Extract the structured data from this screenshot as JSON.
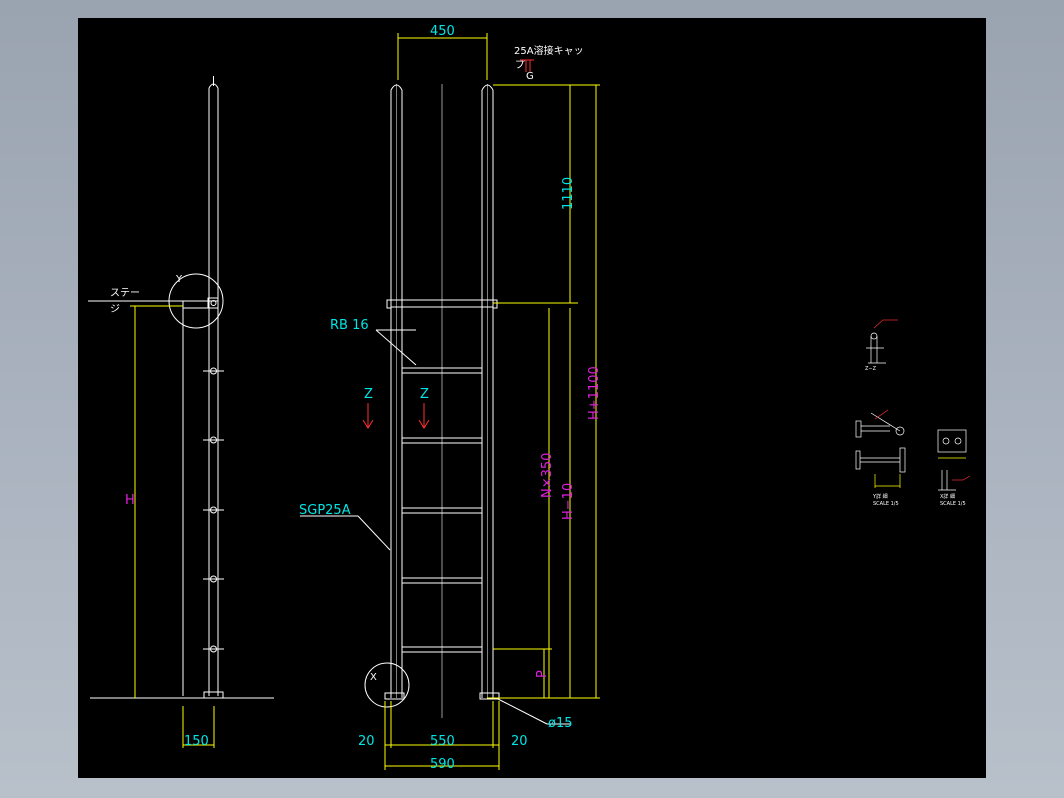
{
  "colors": {
    "background_outer": "#a4adb9",
    "drawing_area": "#000000",
    "geometry": "#ffffff",
    "dimension_line": "#ffff00",
    "dimension_text": "#00e5e5",
    "variable_text": "#e020e0",
    "section_marker": "#ff3030"
  },
  "side_view": {
    "detail_y_label": "Y",
    "stay_label_line1": "ステー",
    "stay_label_line2": "ジ",
    "height_label": "H",
    "width_dim": "150"
  },
  "front_view": {
    "top_width_dim": "450",
    "cap_note": "25A溶接キャッ",
    "cap_note_2": "プ",
    "cap_note_3": "G",
    "rung_label": "RB 16",
    "rail_label": "SGP25A",
    "section_marker_left": "Z",
    "section_marker_right": "Z",
    "detail_x_label": "X",
    "hole_dim": "ø15",
    "dim_1110": "1110",
    "dim_h_plus": "H+1100",
    "dim_nx350": "N×350",
    "dim_h_minus": "H−10",
    "dim_p": "P",
    "bottom_left_offset": "20",
    "bottom_inner": "550",
    "bottom_right_offset": "20",
    "bottom_total": "590"
  },
  "details": {
    "zz_title": "Z−Z",
    "y_title": "Y詳 細",
    "x_title": "X詳 細",
    "note_small": "SCALE 1/5"
  }
}
